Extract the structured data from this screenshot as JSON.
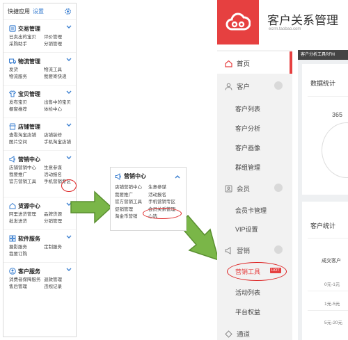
{
  "panel1": {
    "header": {
      "title": "快捷应用",
      "settings": "设置"
    },
    "sections": [
      {
        "title": "交易管理",
        "links": [
          "已卖出的宝贝",
          "评价管理",
          "采购助手",
          "分销管理"
        ]
      },
      {
        "title": "物流管理",
        "links": [
          "发货",
          "物流工具",
          "物流服务",
          "我要寄快递"
        ]
      },
      {
        "title": "宝贝管理",
        "links": [
          "发布宝贝",
          "出售中的宝贝",
          "橱窗推荐",
          "体检中心"
        ]
      },
      {
        "title": "店铺管理",
        "links": [
          "查看淘宝店铺",
          "店铺装修",
          "图片空间",
          "手机淘宝店铺"
        ]
      },
      {
        "title": "营销中心",
        "links": [
          "店铺营销中心",
          "生意参谋",
          "我要推广",
          "活动报名",
          "官方营销工具",
          "手机营销专区"
        ]
      },
      {
        "title": "货源中心",
        "links": [
          "阿里进货管理",
          "品牌货源",
          "批发进货",
          "分销管理"
        ]
      },
      {
        "title": "软件服务",
        "links": [
          "摄影服务",
          "定制服务",
          "我要订购"
        ]
      },
      {
        "title": "客户服务",
        "links": [
          "消费者保障服务",
          "退款管理",
          "售后管理",
          "违规记录"
        ]
      }
    ]
  },
  "panel2": {
    "title": "营销中心",
    "links": [
      "店铺营销中心",
      "生意参谋",
      "我要推广",
      "活动报名",
      "官方营销工具",
      "手机营销专区",
      "促销管理",
      "会员关系管理",
      "淘金币营销",
      "心选"
    ]
  },
  "panel3": {
    "app_name": "客户关系管理",
    "url": "ecrm.taobao.com",
    "topbar": "客户分析工具RFM",
    "nav": {
      "home": "首页",
      "customer": "客户",
      "customer_list": "客户列表",
      "customer_analysis": "客户分析",
      "customer_profile": "客户画像",
      "group_manage": "群组管理",
      "member": "会员",
      "member_card": "会员卡管理",
      "vip_settings": "VIP设置",
      "marketing": "营销",
      "marketing_tools": "营销工具",
      "new_badge": "HOT",
      "activity_list": "活动列表",
      "platform_rights": "平台权益",
      "channel": "通道"
    },
    "data_stats_title": "数据统计",
    "data_stats_value": "365",
    "customer_stats_title": "客户统计",
    "deal_customers": "成交客户",
    "ranges": [
      "0元-1元",
      "1元-5元",
      "5元-20元"
    ]
  },
  "colors": {
    "brand_red": "#e64040",
    "link_blue": "#3b7fd0",
    "arrow_green": "#7ab648",
    "highlight_red": "#dd2222"
  }
}
